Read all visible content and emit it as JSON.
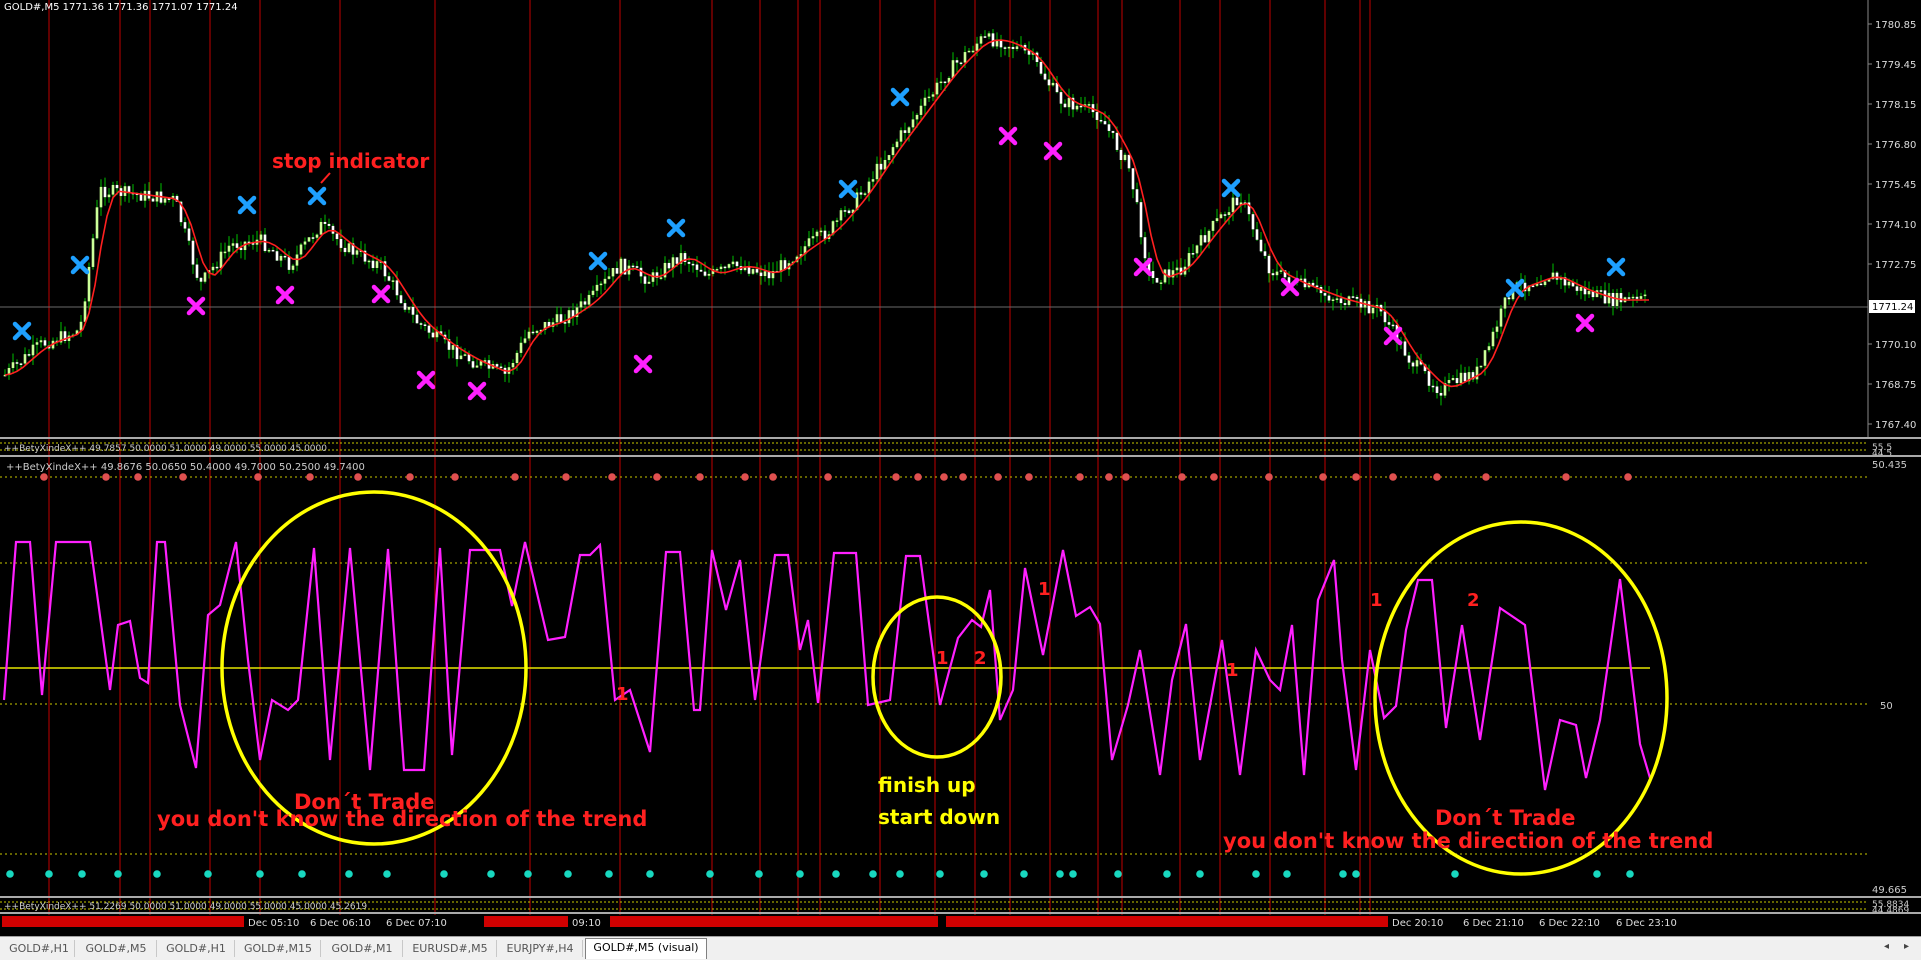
{
  "window": {
    "header_text": "GOLD#,M5  1771.36 1771.36 1771.07 1771.24",
    "price_axis": [
      "1780.85",
      "1779.45",
      "1778.15",
      "1776.80",
      "1775.45",
      "1774.10",
      "1772.75",
      "1771.24",
      "1770.10",
      "1768.75",
      "1767.40"
    ],
    "current_price": "1771.24",
    "subwindow1_header": "++BetyXindeX++ 49.7857 50.0000 51.0000 49.0000 55.0000 45.0000",
    "subwindow1_axis": [
      "55.5",
      "44.5"
    ],
    "subwindow2_header": "++BetyXindeX++ 49.8676 50.0650 50.4000 49.7000 50.2500 49.7400",
    "subwindow2_axis": [
      "50.435",
      "50",
      "49.665"
    ],
    "subwindow3_header": "++BetyXindeX++ 51.2269 50.0000 51.0000 49.0000 55.0000 45.0000 45.2619",
    "subwindow3_axis": [
      "55.8834",
      "44.4869"
    ],
    "time_axis": [
      "Dec 05:10",
      "6 Dec 06:10",
      "6 Dec 07:10",
      "09:10",
      "Dec 20:10",
      "6 Dec 21:10",
      "6 Dec 22:10",
      "6 Dec 23:10"
    ]
  },
  "annotations": {
    "stop_indicator": "stop indicator",
    "dont_trade_left_title": "Don´t Trade",
    "dont_trade_left_sub": "you don't know the direction of the trend",
    "finish_up": "finish up",
    "start_down": "start down",
    "dont_trade_right_title": "Don´t Trade",
    "dont_trade_right_sub": "you don't know the direction of the trend",
    "numbers": [
      "1",
      "1",
      "2",
      "1",
      "1",
      "1",
      "2"
    ]
  },
  "tabs": [
    "GOLD#,H1",
    "GOLD#,M5",
    "GOLD#,H1",
    "GOLD#,M15",
    "GOLD#,M1",
    "EURUSD#,M5",
    "EURJPY#,H4",
    "GOLD#,M5 (visual)"
  ],
  "active_tab": 7,
  "tab_scroll": [
    "◂",
    "▸"
  ],
  "colors": {
    "background": "#000000",
    "bull_candle": "#ccff99",
    "bear_candle": "#ffffff",
    "wick": "#00c000",
    "moving_average": "#ff2020",
    "buy_marker": "#1ea0ff",
    "sell_marker": "#ff20ff",
    "oscillator": "#ff20ff",
    "highlight_circle": "#ffff00",
    "annotation_red": "#ff2020",
    "annotation_yellow": "#ffff00",
    "vertical_lines": "#c00000"
  }
}
